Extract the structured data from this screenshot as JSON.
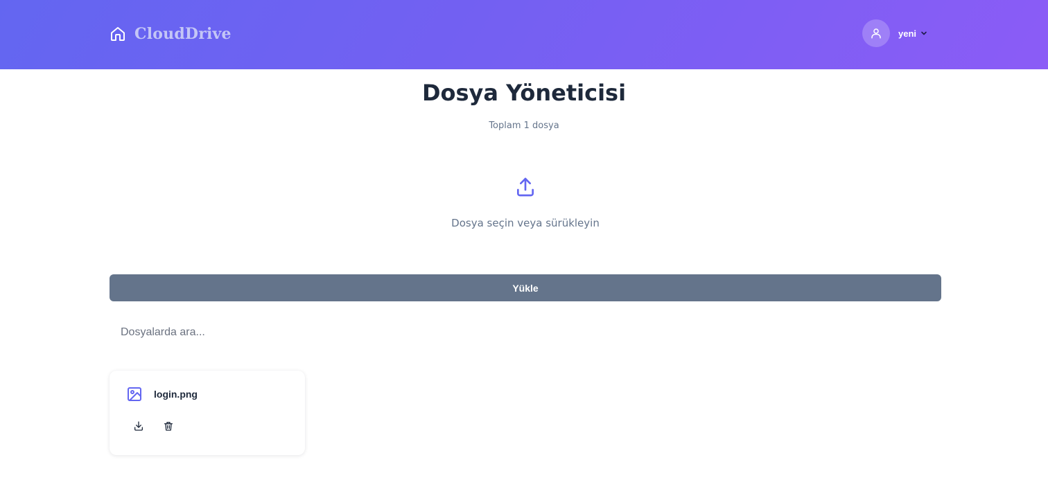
{
  "header": {
    "brand_name": "CloudDrive",
    "brand_icon": "home-icon",
    "user": {
      "name": "yeni",
      "avatar_icon": "user-icon",
      "menu_icon": "chevron-down-icon"
    }
  },
  "main": {
    "title": "Dosya Yöneticisi",
    "subtitle": "Toplam 1 dosya",
    "dropzone": {
      "icon": "upload-icon",
      "text": "Dosya seçin veya sürükleyin"
    },
    "upload_button_label": "Yükle",
    "search": {
      "placeholder": "Dosyalarda ara...",
      "value": ""
    },
    "files": [
      {
        "name": "login.png",
        "icon": "image-icon",
        "actions": [
          "download-icon",
          "trash-icon"
        ]
      }
    ]
  },
  "colors": {
    "header_gradient_start": "#6366f1",
    "header_gradient_end": "#8b5cf6",
    "accent": "#6366f1",
    "button": "#64748b",
    "title_text": "#1e293b",
    "muted_text": "#64748b"
  }
}
